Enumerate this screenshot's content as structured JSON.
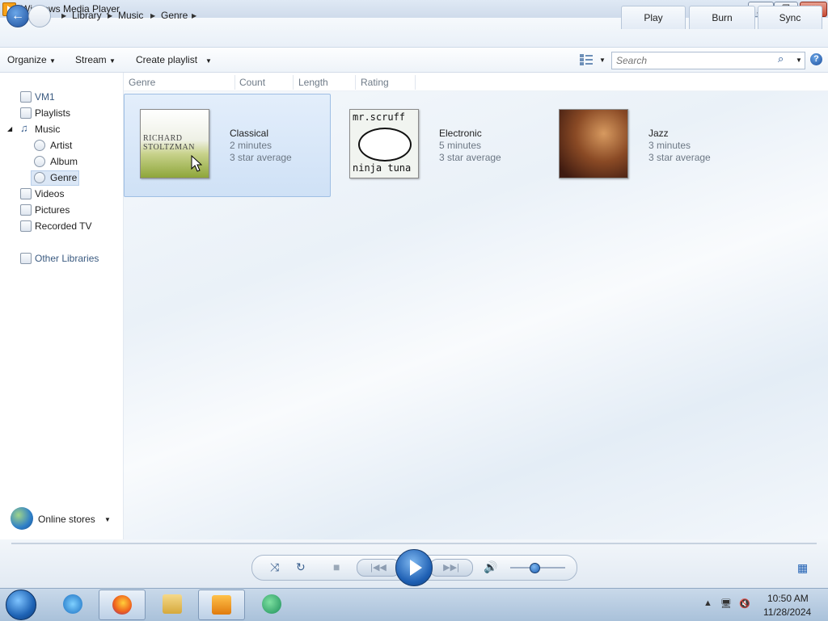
{
  "window": {
    "title": "Windows Media Player"
  },
  "breadcrumb": [
    "Library",
    "Music",
    "Genre"
  ],
  "tabs": [
    "Play",
    "Burn",
    "Sync"
  ],
  "toolbar": {
    "organize": "Organize",
    "stream": "Stream",
    "create_playlist": "Create playlist",
    "search_placeholder": "Search",
    "help": "?"
  },
  "columns": [
    "Genre",
    "Count",
    "Length",
    "Rating"
  ],
  "nav": {
    "vm1": "VM1",
    "playlists": "Playlists",
    "music": "Music",
    "artist": "Artist",
    "album": "Album",
    "genre": "Genre",
    "videos": "Videos",
    "pictures": "Pictures",
    "recorded_tv": "Recorded TV",
    "other_libraries": "Other Libraries",
    "online_stores": "Online stores"
  },
  "genres": [
    {
      "name": "Classical",
      "length": "2 minutes",
      "rating": "3 star average",
      "art_line1": "RICHARD",
      "art_line2": "STOLTZMAN",
      "selected": true
    },
    {
      "name": "Electronic",
      "length": "5 minutes",
      "rating": "3 star average",
      "art_line1": "mr.scruff",
      "art_line2": "ninja tuna",
      "selected": false
    },
    {
      "name": "Jazz",
      "length": "3 minutes",
      "rating": "3 star average",
      "selected": false
    }
  ],
  "player": {
    "volume_level": 0.45
  },
  "taskbar": {
    "time": "10:50 AM",
    "date": "11/28/2024",
    "apps": [
      "internet-explorer",
      "firefox",
      "file-explorer",
      "windows-media-player",
      "media-center"
    ]
  },
  "colors": {
    "accent": "#1e5fb3",
    "selection": "#cfe1f6"
  }
}
